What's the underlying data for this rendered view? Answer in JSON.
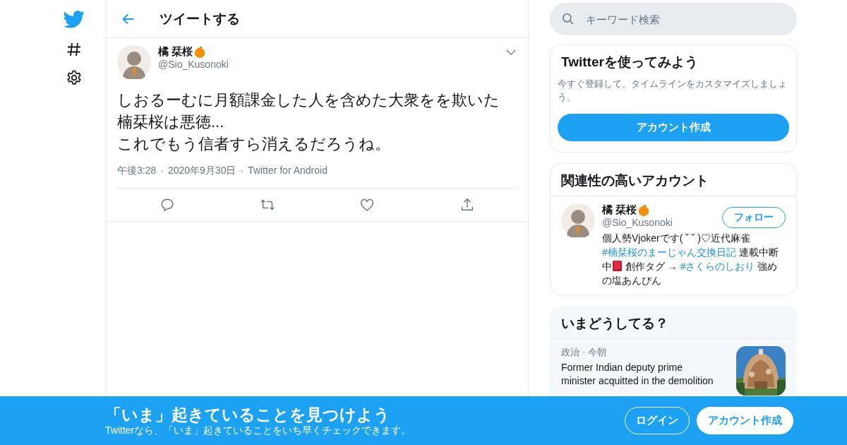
{
  "header": {
    "title": "ツイートする"
  },
  "tweet": {
    "name": "橘 栞桜",
    "handle": "@Sio_Kusonoki",
    "lines": [
      "しおるーむに月額課金した人を含めた大衆をを欺いた",
      "楠栞桜は悪徳...",
      "これでもう信者すら消えるだろうね。"
    ],
    "meta": [
      "午後3:28",
      "2020年9月30日",
      "Twitter for Android"
    ],
    "separator": "·"
  },
  "search": {
    "placeholder": "キーワード検索"
  },
  "signup": {
    "title": "Twitterを使ってみよう",
    "text": "今すぐ登録して、タイムラインをカスタマイズしましょう。",
    "button": "アカウント作成"
  },
  "related": {
    "title": "関連性の高いアカウント",
    "name": "橘 栞桜",
    "handle": "@Sio_Kusonoki",
    "follow": "フォロー",
    "bio": [
      {
        "kind": "text",
        "text": "個人勢Vjokerです( ˘ ˘ )♡近代麻雀 "
      },
      {
        "kind": "hashtag",
        "text": "#楠栞桜のまーじゃん交換日記"
      },
      {
        "kind": "text",
        "text": " 連載中断中"
      },
      {
        "kind": "book"
      },
      {
        "kind": "text",
        "text": " 創作タグ → "
      },
      {
        "kind": "hashtag",
        "text": "#さくらのしおり"
      },
      {
        "kind": "text",
        "text": " 強めの塩あんびん"
      }
    ]
  },
  "trends": {
    "title": "いまどうしてる？",
    "items": [
      {
        "category": "政治",
        "separator": "·",
        "time": "今朝",
        "headline_lines": [
          "Former Indian deputy prime",
          "minister acquitted in the demolition"
        ],
        "kind": "picture"
      }
    ]
  },
  "banner": {
    "title": "「いま」起きていることを見つけよう",
    "subtitle": "Twitterなら、「いま」起きていることをいち早くチェックできます。",
    "login": "ログイン",
    "signup": "アカウント作成"
  }
}
